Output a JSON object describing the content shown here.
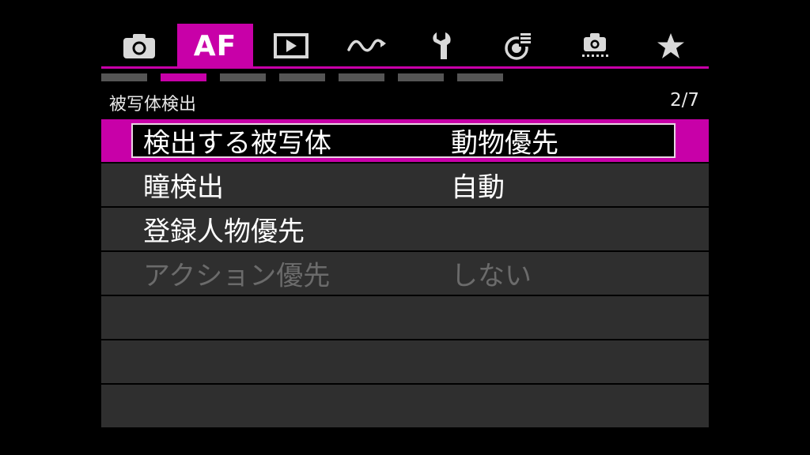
{
  "tabs": [
    {
      "name": "camera-icon",
      "text": ""
    },
    {
      "name": "af",
      "text": "AF"
    },
    {
      "name": "playback-icon",
      "text": ""
    },
    {
      "name": "wave-icon",
      "text": ""
    },
    {
      "name": "wrench-icon",
      "text": ""
    },
    {
      "name": "network-icon",
      "text": ""
    },
    {
      "name": "custom-icon",
      "text": ""
    },
    {
      "name": "star-icon",
      "text": ""
    }
  ],
  "active_tab_index": 1,
  "page_segments": 7,
  "active_segment_index": 1,
  "header": {
    "title": "被写体検出",
    "page": "2/7"
  },
  "menu": {
    "items": [
      {
        "label": "検出する被写体",
        "value": "動物優先",
        "selected": true,
        "disabled": false
      },
      {
        "label": "瞳検出",
        "value": "自動",
        "selected": false,
        "disabled": false
      },
      {
        "label": "登録人物優先",
        "value": "",
        "selected": false,
        "disabled": false
      },
      {
        "label": "アクション優先",
        "value": "しない",
        "selected": false,
        "disabled": true
      },
      {
        "label": "",
        "value": "",
        "selected": false,
        "disabled": false
      },
      {
        "label": "",
        "value": "",
        "selected": false,
        "disabled": false
      },
      {
        "label": "",
        "value": "",
        "selected": false,
        "disabled": false
      }
    ]
  },
  "colors": {
    "accent": "#c800a8",
    "row_bg": "#2f2f2f",
    "disabled_text": "#6b6b6b"
  }
}
